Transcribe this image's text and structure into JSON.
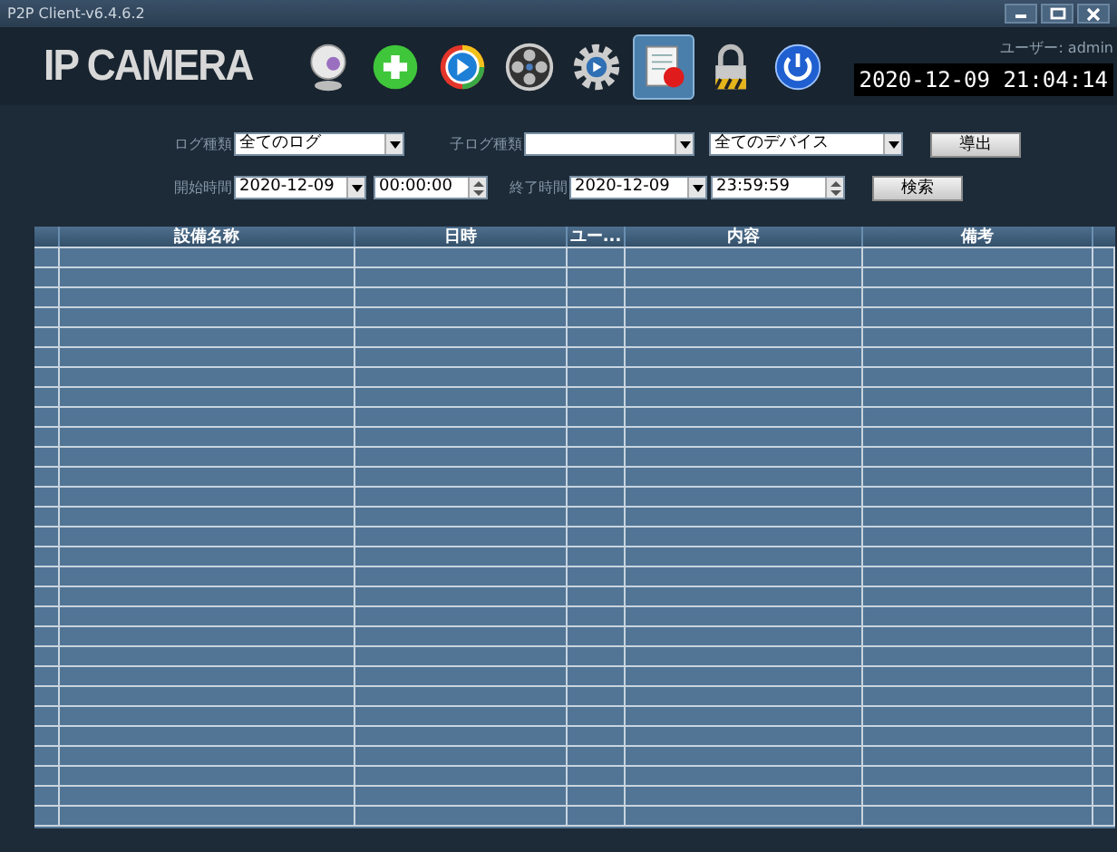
{
  "window": {
    "title": "P2P Client-v6.4.6.2"
  },
  "header": {
    "logo": "IP CAMERA",
    "user": "ユーザー: admin",
    "datetime": "2020-12-09 21:04:14"
  },
  "toolbar": [
    {
      "kind": "webcam",
      "selected": false
    },
    {
      "kind": "add",
      "selected": false
    },
    {
      "kind": "play",
      "selected": false
    },
    {
      "kind": "reel",
      "selected": false
    },
    {
      "kind": "settings",
      "selected": false
    },
    {
      "kind": "log",
      "selected": true
    },
    {
      "kind": "lock",
      "selected": false
    },
    {
      "kind": "power",
      "selected": false
    }
  ],
  "filters": {
    "log_type": {
      "label": "ログ種類",
      "value": "全てのログ"
    },
    "sub_log_type": {
      "label": "子ログ種類"
    },
    "device": {
      "value": "全てのデバイス"
    },
    "export_button": "導出",
    "start": {
      "label": "開始時間",
      "date": "2020-12-09",
      "time": "00:00:00"
    },
    "end": {
      "label": "終了時間",
      "date": "2020-12-09",
      "time": "23:59:59"
    },
    "search_button": "検索"
  },
  "table": {
    "columns": [
      "設備名称",
      "日時",
      "ユー...",
      "内容",
      "備考"
    ]
  }
}
